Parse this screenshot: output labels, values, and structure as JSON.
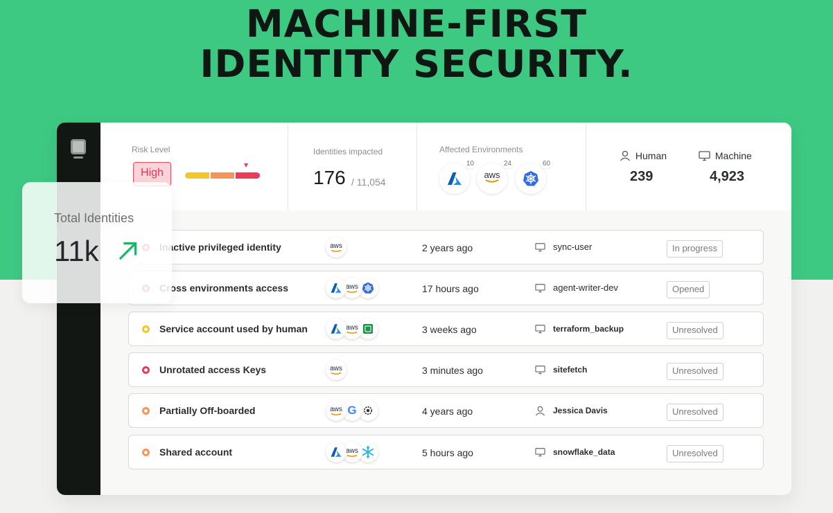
{
  "hero": {
    "line1": "MACHINE-FIRST",
    "line2": "IDENTITY SECURITY."
  },
  "colors": {
    "brand_green": "#3ec983",
    "risk_high": "#ed3a5a",
    "risk_medium": "#f6945a",
    "risk_low": "#f2c72a",
    "trend_green": "#1fb36a"
  },
  "metrics": {
    "risk": {
      "label": "Risk Level",
      "value": "High"
    },
    "identities": {
      "label": "Identities impacted",
      "value": "176",
      "total": "/ 11,054"
    },
    "environments": {
      "label": "Affected Environments",
      "items": [
        {
          "icon": "azure-icon",
          "count": "10"
        },
        {
          "icon": "aws-icon",
          "label": "aws",
          "count": "24"
        },
        {
          "icon": "kubernetes-icon",
          "count": "60"
        }
      ]
    },
    "human": {
      "label": "Human",
      "value": "239"
    },
    "machine": {
      "label": "Machine",
      "value": "4,923"
    }
  },
  "total_card": {
    "label": "Total Identities",
    "value": "11k",
    "trend_icon": "arrow-up-right-icon"
  },
  "rows": [
    {
      "severity": "high",
      "title": "Inactive privileged identity",
      "envs": [
        "aws"
      ],
      "time": "2 years ago",
      "user_type": "machine",
      "user": "sync-user",
      "status": "In progress"
    },
    {
      "severity": "high",
      "title": "Cross environments access",
      "envs": [
        "azure",
        "aws",
        "kubernetes"
      ],
      "time": "17 hours ago",
      "user_type": "machine",
      "user": "agent-writer-dev",
      "status": "Opened"
    },
    {
      "severity": "low",
      "title": "Service account used by human",
      "envs": [
        "azure",
        "aws",
        "app"
      ],
      "time": "3 weeks ago",
      "user_type": "machine",
      "user": "terraform_backup",
      "status": "Unresolved"
    },
    {
      "severity": "high",
      "title": "Unrotated access Keys",
      "envs": [
        "aws"
      ],
      "time": "3 minutes ago",
      "user_type": "machine",
      "user": "sitefetch",
      "status": "Unresolved"
    },
    {
      "severity": "medium",
      "title": "Partially Off-boarded",
      "envs": [
        "aws",
        "google",
        "openai"
      ],
      "time": "4 years ago",
      "user_type": "human",
      "user": "Jessica Davis",
      "status": "Unresolved"
    },
    {
      "severity": "medium",
      "title": "Shared account",
      "envs": [
        "azure",
        "aws",
        "snowflake"
      ],
      "time": "5 hours ago",
      "user_type": "machine",
      "user": "snowflake_data",
      "status": "Unresolved"
    }
  ],
  "env_labels": {
    "aws": "aws",
    "google": "G"
  }
}
